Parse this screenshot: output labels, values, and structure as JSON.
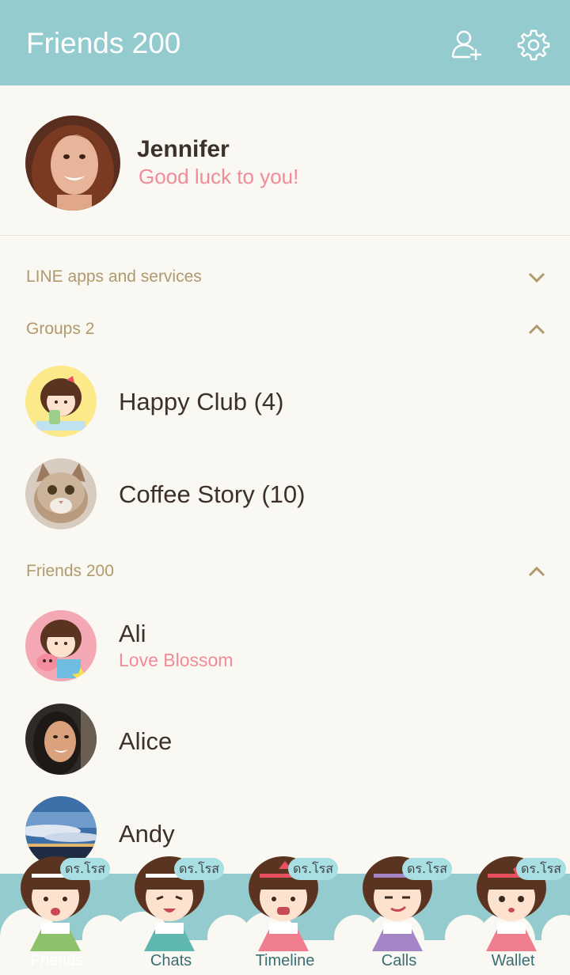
{
  "header": {
    "title": "Friends 200",
    "icons": [
      "add-friend-icon",
      "settings-icon"
    ]
  },
  "profile": {
    "name": "Jennifer",
    "status": "Good luck to you!"
  },
  "sections": {
    "services": {
      "label": "LINE apps and services",
      "state": "collapsed"
    },
    "groups": {
      "label": "Groups 2",
      "state": "expanded"
    },
    "friends": {
      "label": "Friends 200",
      "state": "expanded"
    }
  },
  "groups": [
    {
      "name": "Happy Club (4)"
    },
    {
      "name": "Coffee Story (10)"
    }
  ],
  "friends": [
    {
      "name": "Ali",
      "status": "Love Blossom"
    },
    {
      "name": "Alice",
      "status": ""
    },
    {
      "name": "Andy",
      "status": ""
    }
  ],
  "tabs": [
    {
      "label": "Friends",
      "badge": "ดร.โรส",
      "dress": "#8dc16a"
    },
    {
      "label": "Chats",
      "badge": "ดร.โรส",
      "dress": "#5fb8b0"
    },
    {
      "label": "Timeline",
      "badge": "ดร.โรส",
      "dress": "#f07d8e"
    },
    {
      "label": "Calls",
      "badge": "ดร.โรส",
      "dress": "#a486c6"
    },
    {
      "label": "Wallet",
      "badge": "ดร.โรส",
      "dress": "#f07d8e"
    }
  ],
  "colors": {
    "header": "#94cbce",
    "accent_pink": "#f08b97",
    "section_gold": "#b09a6d"
  }
}
